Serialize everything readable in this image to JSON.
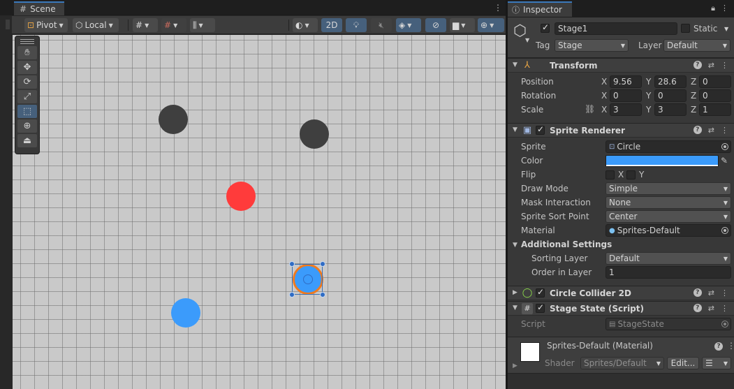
{
  "scene": {
    "tab_label": "Scene",
    "toolbar": {
      "pivot": "Pivot",
      "space": "Local",
      "mode_2d": "2D"
    }
  },
  "inspector": {
    "tab_label": "Inspector",
    "object_name": "Stage1",
    "static_label": "Static",
    "tag_label": "Tag",
    "tag_value": "Stage",
    "layer_label": "Layer",
    "layer_value": "Default",
    "transform": {
      "title": "Transform",
      "position_label": "Position",
      "rotation_label": "Rotation",
      "scale_label": "Scale",
      "axis_x": "X",
      "axis_y": "Y",
      "axis_z": "Z",
      "position": {
        "x": "9.56",
        "y": "28.6",
        "z": "0"
      },
      "rotation": {
        "x": "0",
        "y": "0",
        "z": "0"
      },
      "scale": {
        "x": "3",
        "y": "3",
        "z": "1"
      }
    },
    "sprite_renderer": {
      "title": "Sprite Renderer",
      "sprite_label": "Sprite",
      "sprite_value": "Circle",
      "color_label": "Color",
      "color_value": "#3b9bfb",
      "flip_label": "Flip",
      "flip_x": "X",
      "flip_y": "Y",
      "draw_mode_label": "Draw Mode",
      "draw_mode_value": "Simple",
      "mask_label": "Mask Interaction",
      "mask_value": "None",
      "sort_point_label": "Sprite Sort Point",
      "sort_point_value": "Center",
      "material_label": "Material",
      "material_value": "Sprites-Default",
      "additional_label": "Additional Settings",
      "sorting_layer_label": "Sorting Layer",
      "sorting_layer_value": "Default",
      "order_label": "Order in Layer",
      "order_value": "1"
    },
    "collider": {
      "title": "Circle Collider 2D"
    },
    "stage_state": {
      "title": "Stage State (Script)",
      "script_label": "Script",
      "script_value": "StageState"
    },
    "material": {
      "title": "Sprites-Default (Material)",
      "shader_label": "Shader",
      "shader_value": "Sprites/Default",
      "edit_label": "Edit..."
    }
  },
  "colors": {
    "dark_circle": "#3f3f3f",
    "red_circle": "#ff3b3b",
    "blue_circle": "#3b9bfb",
    "selection_outline": "#f07a1e",
    "accent": "#3a79bb"
  }
}
